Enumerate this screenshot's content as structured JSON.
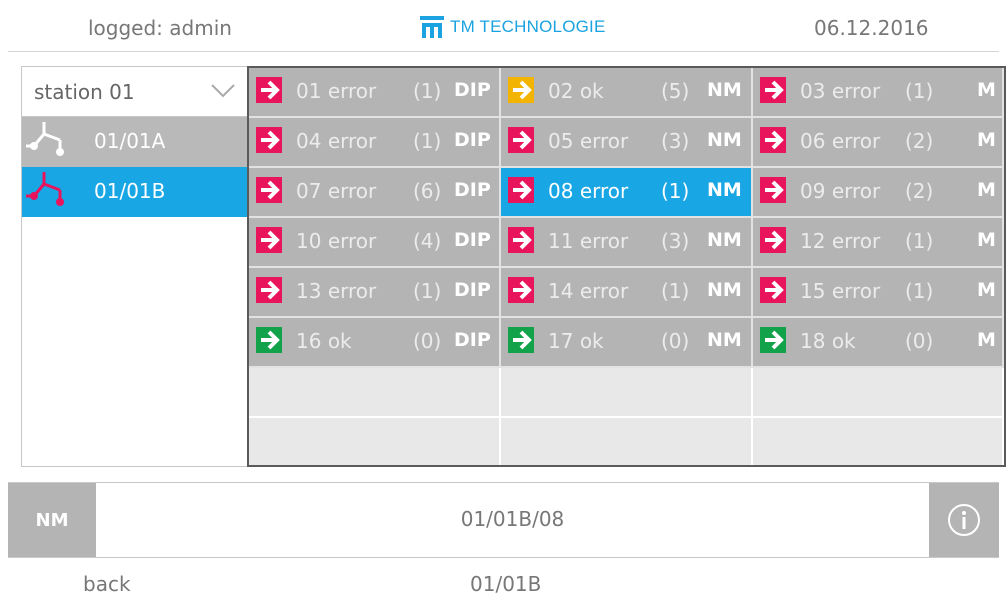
{
  "header": {
    "user": "logged: admin",
    "brand": "TM TECHNOLOGIE",
    "date": "06.12.2016",
    "brand_color": "#1aa3e0"
  },
  "sidebar": {
    "station": "station 01",
    "items": [
      {
        "label": "01/01A",
        "icon": "branch-icon",
        "selected": false
      },
      {
        "label": "01/01B",
        "icon": "branch-icon",
        "selected": true
      }
    ]
  },
  "grid": {
    "columns": 3,
    "rows": [
      [
        {
          "num": "01",
          "status": "error",
          "count": "(1)",
          "type": "DIP"
        },
        {
          "num": "02",
          "status": "ok",
          "count": "(5)",
          "type": "NM",
          "warn": true
        },
        {
          "num": "03",
          "status": "error",
          "count": "(1)",
          "type": "M"
        }
      ],
      [
        {
          "num": "04",
          "status": "error",
          "count": "(1)",
          "type": "DIP"
        },
        {
          "num": "05",
          "status": "error",
          "count": "(3)",
          "type": "NM"
        },
        {
          "num": "06",
          "status": "error",
          "count": "(2)",
          "type": "M"
        }
      ],
      [
        {
          "num": "07",
          "status": "error",
          "count": "(6)",
          "type": "DIP"
        },
        {
          "num": "08",
          "status": "error",
          "count": "(1)",
          "type": "NM",
          "selected": true
        },
        {
          "num": "09",
          "status": "error",
          "count": "(2)",
          "type": "M"
        }
      ],
      [
        {
          "num": "10",
          "status": "error",
          "count": "(4)",
          "type": "DIP"
        },
        {
          "num": "11",
          "status": "error",
          "count": "(3)",
          "type": "NM"
        },
        {
          "num": "12",
          "status": "error",
          "count": "(1)",
          "type": "M"
        }
      ],
      [
        {
          "num": "13",
          "status": "error",
          "count": "(1)",
          "type": "DIP"
        },
        {
          "num": "14",
          "status": "error",
          "count": "(1)",
          "type": "NM"
        },
        {
          "num": "15",
          "status": "error",
          "count": "(1)",
          "type": "M"
        }
      ],
      [
        {
          "num": "16",
          "status": "ok",
          "count": "(0)",
          "type": "DIP"
        },
        {
          "num": "17",
          "status": "ok",
          "count": "(0)",
          "type": "NM"
        },
        {
          "num": "18",
          "status": "ok",
          "count": "(0)",
          "type": "M"
        }
      ]
    ],
    "status_colors": {
      "error": "#e8145c",
      "ok": "#12a34a",
      "warn": "#f2b400"
    }
  },
  "footer": {
    "type": "NM",
    "path": "01/01B/08",
    "info_icon": "info-icon",
    "back": "back",
    "current": "01/01B"
  }
}
